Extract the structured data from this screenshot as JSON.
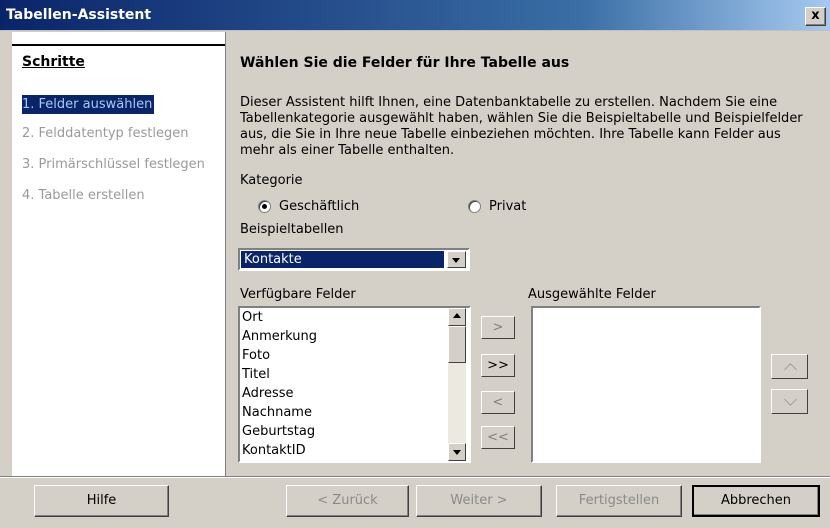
{
  "window": {
    "title": "Tabellen-Assistent",
    "close_label": "x"
  },
  "steps": {
    "title": "Schritte",
    "items": [
      {
        "label": "1. Felder auswählen",
        "active": true
      },
      {
        "label": "2. Felddatentyp festlegen",
        "active": false
      },
      {
        "label": "3. Primärschlüssel festlegen",
        "active": false
      },
      {
        "label": "4. Tabelle erstellen",
        "active": false
      }
    ]
  },
  "main": {
    "heading": "Wählen Sie die Felder für Ihre Tabelle aus",
    "description": "Dieser Assistent hilft Ihnen, eine Datenbanktabelle zu erstellen. Nachdem Sie eine Tabellenkategorie ausgewählt haben, wählen Sie die Beispieltabelle und Beispielfelder aus, die Sie in Ihre neue Tabelle einbeziehen möchten. Ihre Tabelle kann Felder aus mehr als einer Tabelle enthalten.",
    "kategorie_label": "Kategorie",
    "kategorie_options": [
      {
        "label": "Geschäftlich",
        "checked": true
      },
      {
        "label": "Privat",
        "checked": false
      }
    ],
    "beispieltabellen_label": "Beispieltabellen",
    "beispieltabellen_value": "Kontakte",
    "available_label": "Verfügbare Felder",
    "available_fields": [
      "Ort",
      "Anmerkung",
      "Foto",
      "Titel",
      "Adresse",
      "Nachname",
      "Geburtstag",
      "KontaktID"
    ],
    "selected_label": "Ausgewählte Felder",
    "selected_fields": [],
    "transfer_buttons": {
      "add": ">",
      "add_all": ">>",
      "remove": "<",
      "remove_all": "<<"
    }
  },
  "buttons": {
    "hilfe": "Hilfe",
    "zurueck": "< Zurück",
    "weiter": "Weiter >",
    "fertigstellen": "Fertigstellen",
    "abbrechen": "Abbrechen"
  }
}
